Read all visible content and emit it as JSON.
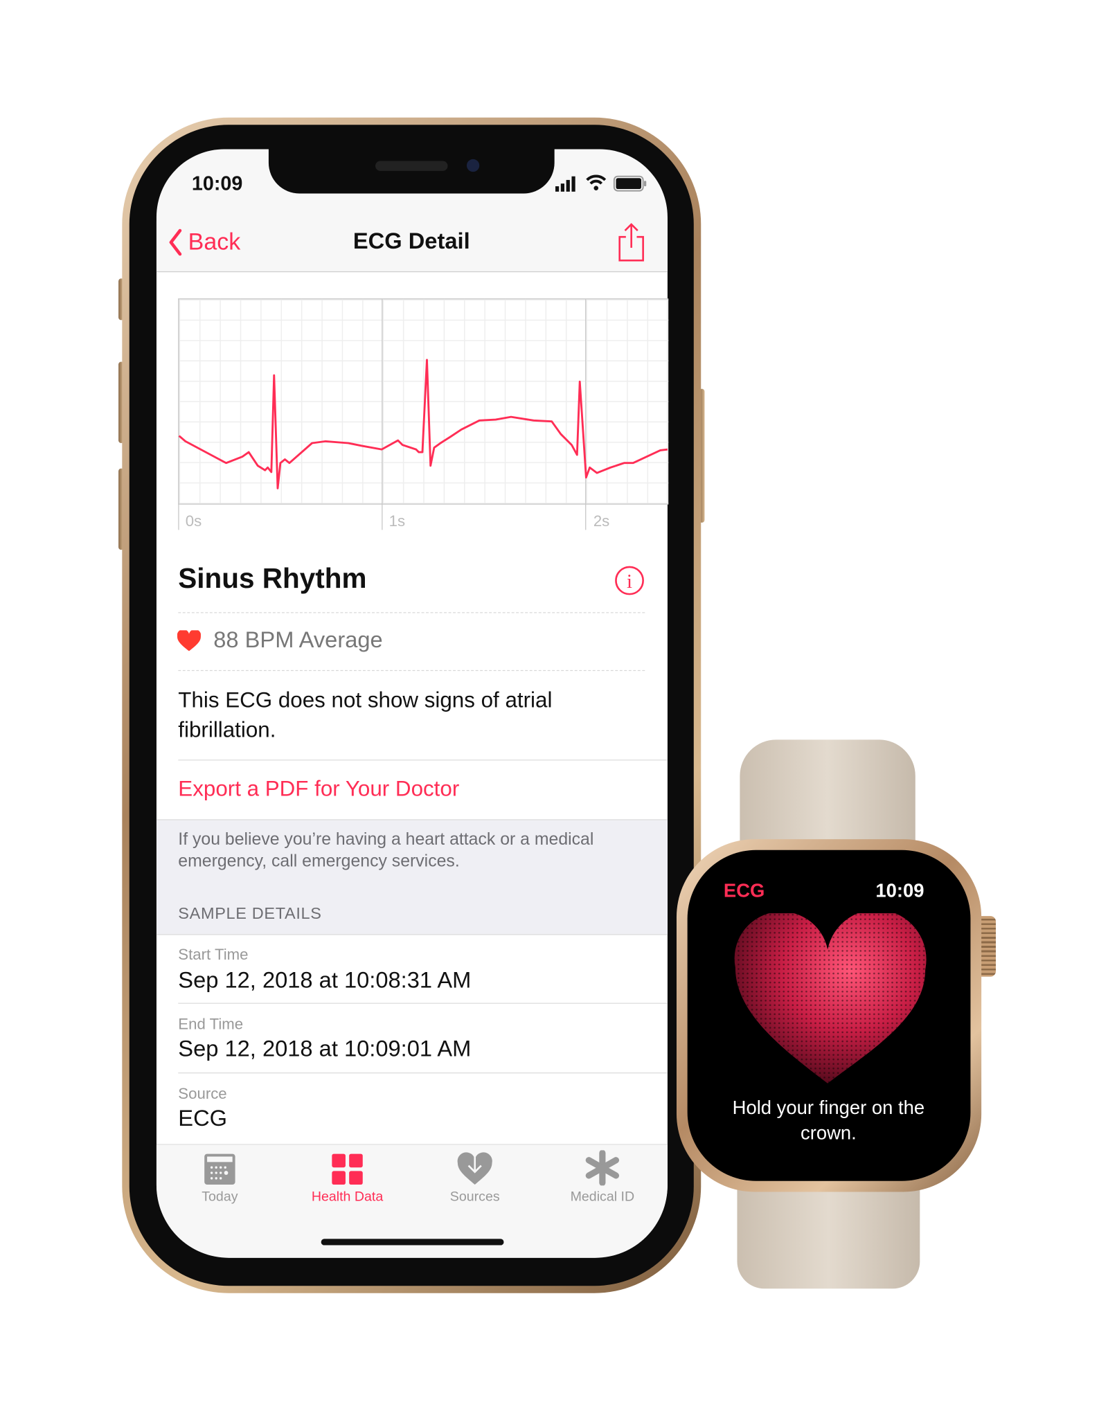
{
  "phone": {
    "status_time": "10:09",
    "nav": {
      "back_label": "Back",
      "title": "ECG Detail"
    },
    "chart": {
      "tick_labels": [
        "0s",
        "1s",
        "2s"
      ],
      "line_color": "#ff2d55"
    },
    "classification": "Sinus Rhythm",
    "heart_rate": "88 BPM Average",
    "description": "This ECG does not show signs of atrial fibrillation.",
    "export_link": "Export a PDF for Your Doctor",
    "warning": "If you believe you’re having a heart attack or a medical emergency, call emergency services.",
    "section_header": "SAMPLE DETAILS",
    "details": [
      {
        "label": "Start Time",
        "value": "Sep 12, 2018 at 10:08:31 AM"
      },
      {
        "label": "End Time",
        "value": "Sep 12, 2018 at 10:09:01 AM"
      },
      {
        "label": "Source",
        "value": "ECG"
      }
    ],
    "tabs": [
      {
        "label": "Today",
        "icon": "calendar-icon",
        "active": false
      },
      {
        "label": "Health Data",
        "icon": "grid-icon",
        "active": true
      },
      {
        "label": "Sources",
        "icon": "heart-download-icon",
        "active": false
      },
      {
        "label": "Medical ID",
        "icon": "asterisk-icon",
        "active": false
      }
    ],
    "accent_color": "#ff2d55"
  },
  "watch": {
    "app_label": "ECG",
    "time": "10:09",
    "instruction": "Hold your finger on the crown."
  }
}
